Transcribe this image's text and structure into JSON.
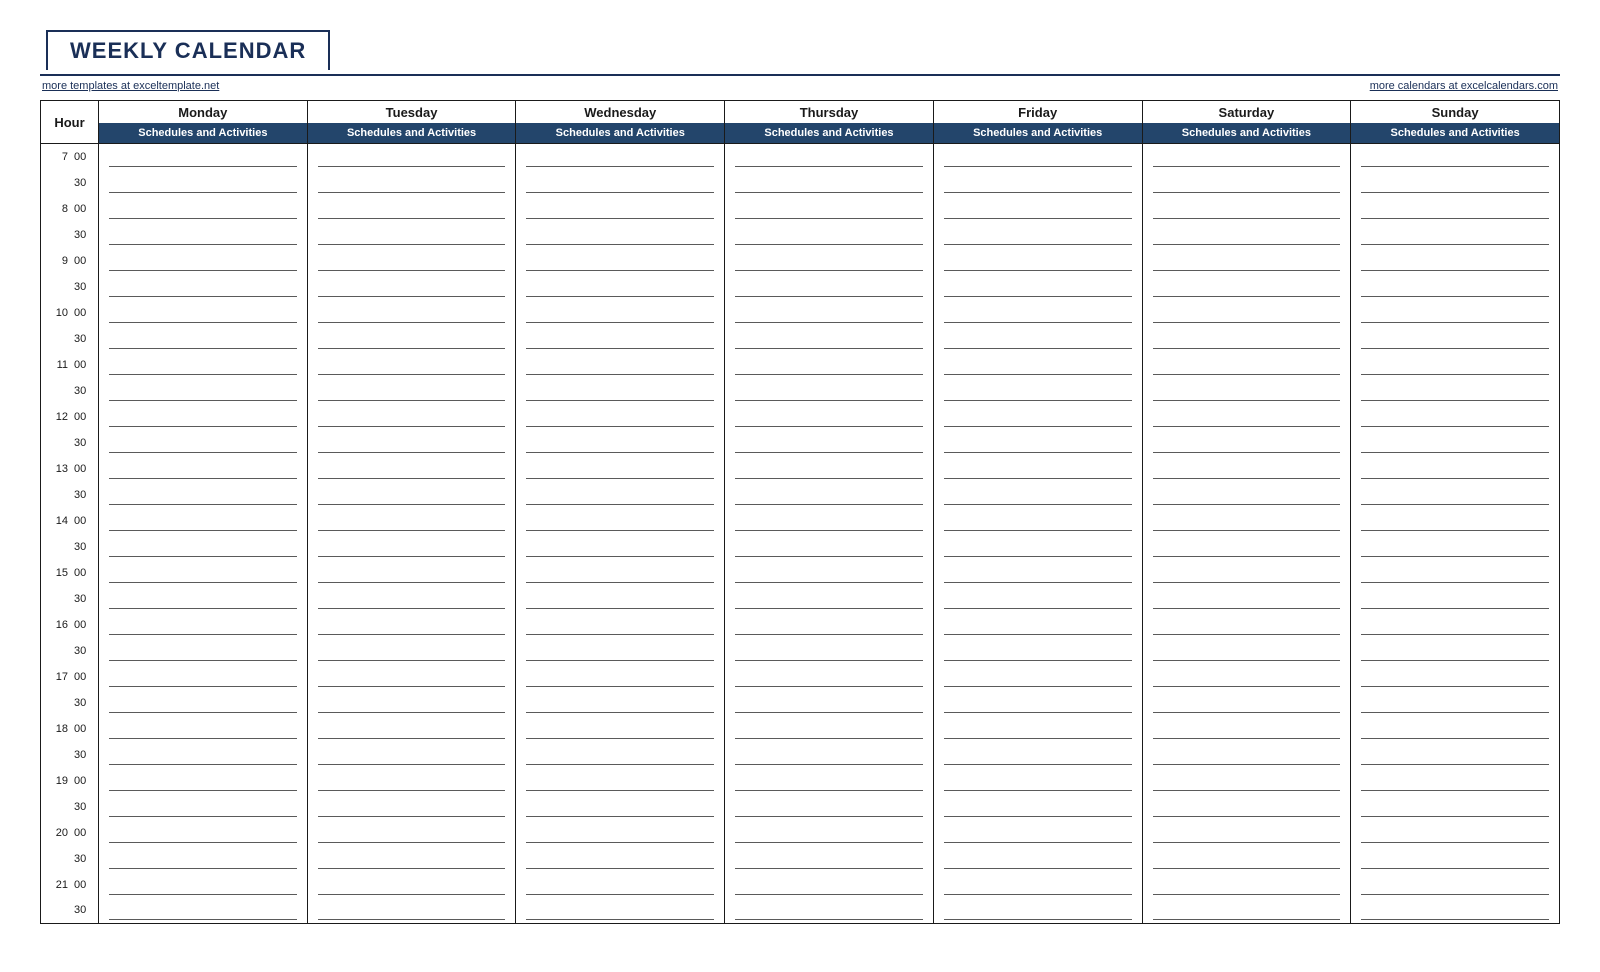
{
  "title": "WEEKLY CALENDAR",
  "links": {
    "left": "more templates at exceltemplate.net",
    "right": "more calendars at excelcalendars.com"
  },
  "header": {
    "hour_label": "Hour",
    "sub_label": "Schedules and Activities",
    "days": [
      "Monday",
      "Tuesday",
      "Wednesday",
      "Thursday",
      "Friday",
      "Saturday",
      "Sunday"
    ]
  },
  "time_rows": [
    {
      "hour": "7",
      "minute": "00"
    },
    {
      "hour": "",
      "minute": "30"
    },
    {
      "hour": "8",
      "minute": "00"
    },
    {
      "hour": "",
      "minute": "30"
    },
    {
      "hour": "9",
      "minute": "00"
    },
    {
      "hour": "",
      "minute": "30"
    },
    {
      "hour": "10",
      "minute": "00"
    },
    {
      "hour": "",
      "minute": "30"
    },
    {
      "hour": "11",
      "minute": "00"
    },
    {
      "hour": "",
      "minute": "30"
    },
    {
      "hour": "12",
      "minute": "00"
    },
    {
      "hour": "",
      "minute": "30"
    },
    {
      "hour": "13",
      "minute": "00"
    },
    {
      "hour": "",
      "minute": "30"
    },
    {
      "hour": "14",
      "minute": "00"
    },
    {
      "hour": "",
      "minute": "30"
    },
    {
      "hour": "15",
      "minute": "00"
    },
    {
      "hour": "",
      "minute": "30"
    },
    {
      "hour": "16",
      "minute": "00"
    },
    {
      "hour": "",
      "minute": "30"
    },
    {
      "hour": "17",
      "minute": "00"
    },
    {
      "hour": "",
      "minute": "30"
    },
    {
      "hour": "18",
      "minute": "00"
    },
    {
      "hour": "",
      "minute": "30"
    },
    {
      "hour": "19",
      "minute": "00"
    },
    {
      "hour": "",
      "minute": "30"
    },
    {
      "hour": "20",
      "minute": "00"
    },
    {
      "hour": "",
      "minute": "30"
    },
    {
      "hour": "21",
      "minute": "00"
    },
    {
      "hour": "",
      "minute": "30"
    }
  ]
}
